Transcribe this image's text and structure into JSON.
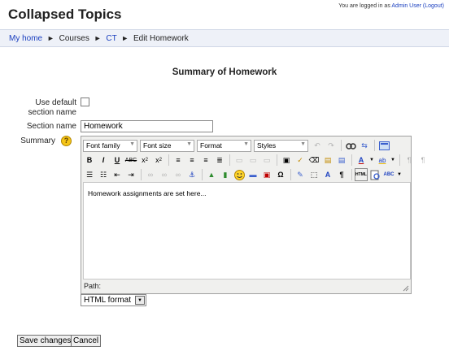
{
  "header": {
    "site_title": "Collapsed Topics",
    "login_prefix": "You are logged in as",
    "user_name": "Admin User",
    "logout_label": "(Logout)"
  },
  "breadcrumb": {
    "items": [
      "My home",
      "Courses",
      "CT",
      "Edit Homework"
    ],
    "separator": "►"
  },
  "form": {
    "heading": "Summary of Homework",
    "use_default_label_line1": "Use default",
    "use_default_label_line2": "section name",
    "section_name_label": "Section name",
    "section_name_value": "Homework",
    "summary_label": "Summary",
    "help_glyph": "?",
    "editor": {
      "font_family": "Font family",
      "font_size": "Font size",
      "format": "Format",
      "styles": "Styles",
      "content": "Homework assignments are set here...",
      "path_label": "Path:"
    },
    "text_format": "HTML format",
    "save_label": "Save changes",
    "cancel_label": "Cancel"
  },
  "colors": {
    "link": "#1a3fbf",
    "navbar_bg": "#eef1f8",
    "help_icon": "#f5c518"
  }
}
